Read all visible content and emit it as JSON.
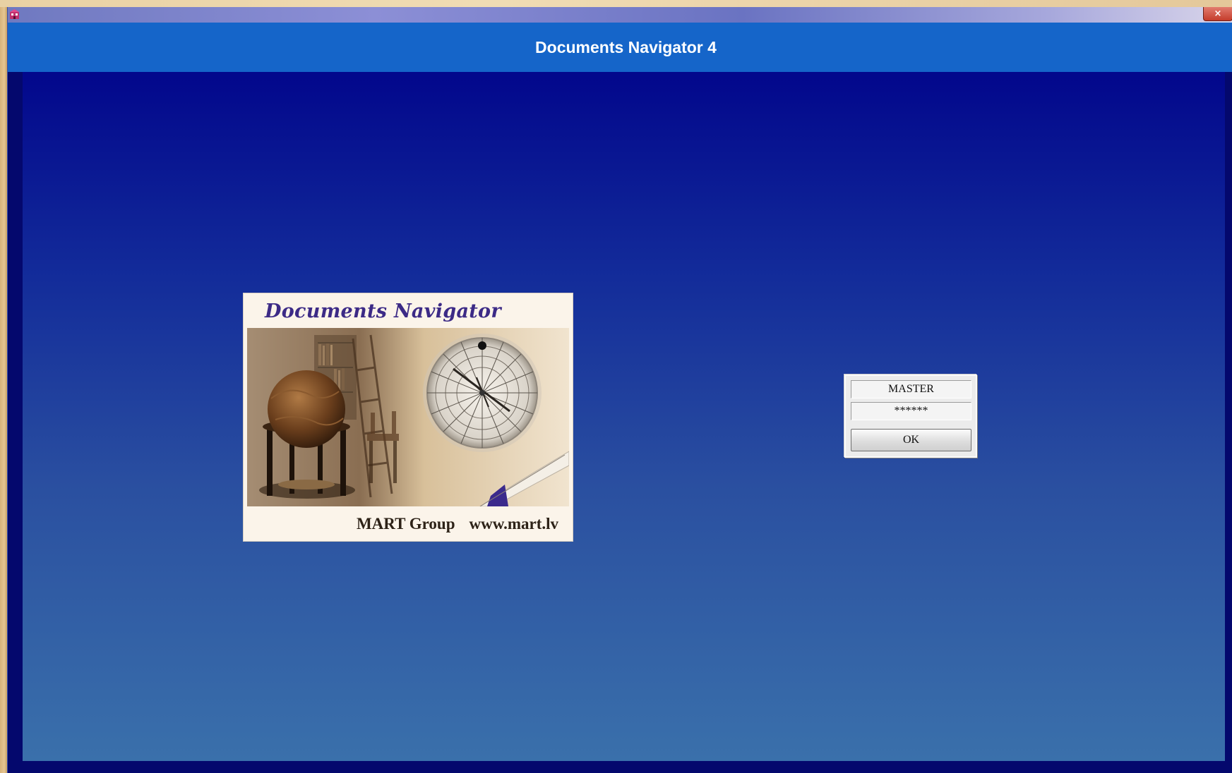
{
  "window": {
    "close_label": "×"
  },
  "header": {
    "title": "Documents Navigator 4"
  },
  "splash": {
    "title": "Documents Navigator",
    "company": "MART Group",
    "website": "www.mart.lv"
  },
  "login": {
    "username": "MASTER",
    "password": "******",
    "ok_label": "OK"
  },
  "colors": {
    "header_band": "#1565c9",
    "content_top": "#02078c",
    "content_bottom": "#3a70ab",
    "splash_title": "#3c2a86"
  }
}
